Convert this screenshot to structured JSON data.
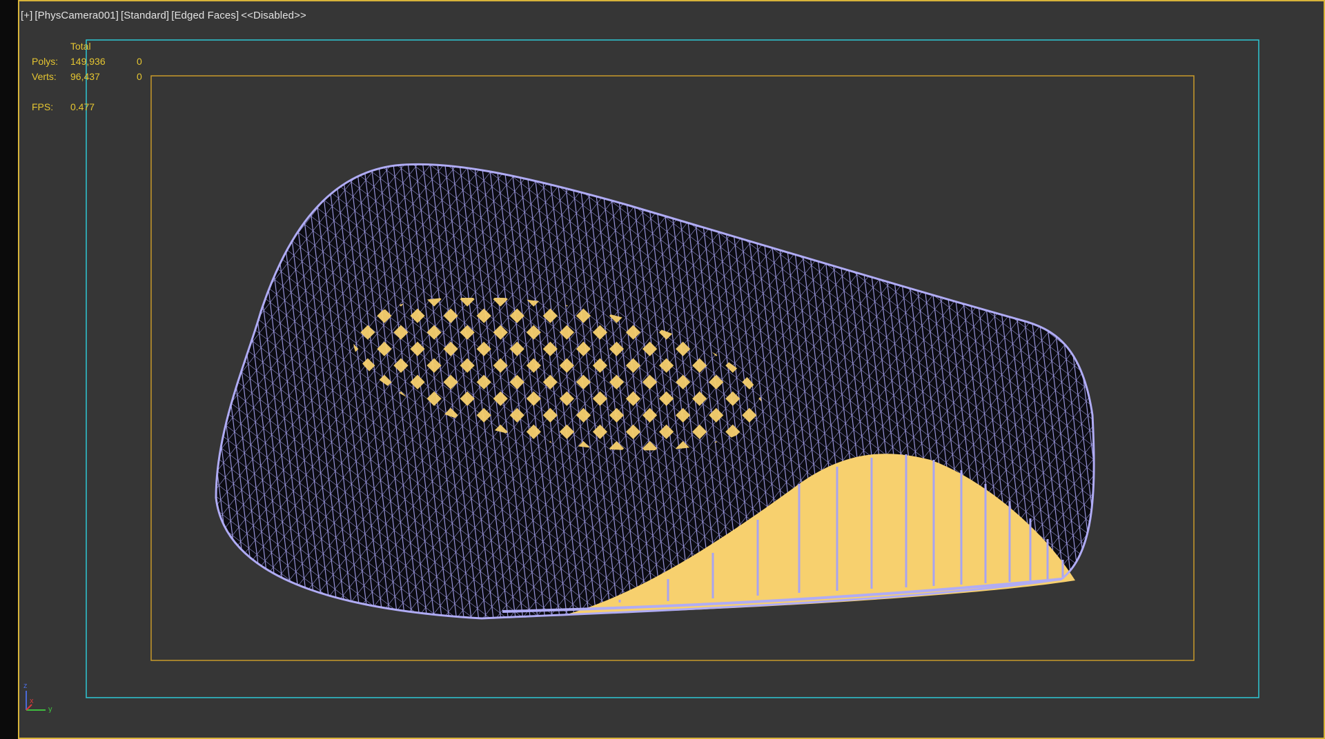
{
  "viewport": {
    "label_parts": [
      "[+]",
      "[PhysCamera001]",
      "[Standard]",
      "[Edged Faces]",
      "<<Disabled>>"
    ]
  },
  "stats": {
    "header": "Total",
    "polys_label": "Polys:",
    "polys_total": "149,936",
    "polys_selected": "0",
    "verts_label": "Verts:",
    "verts_total": "96,437",
    "verts_selected": "0",
    "fps_label": "FPS:",
    "fps_value": "0.477"
  },
  "axis": {
    "z": "z",
    "x": "x",
    "y": "y"
  },
  "colors": {
    "viewport_bg": "#363636",
    "active_border": "#d8b43a",
    "safe_frame_outer": "#2fc8d6",
    "safe_frame_inner": "#c99a2a",
    "wireframe": "#a8a4f0",
    "fill": "#f7d06e",
    "stats_text": "#e6c631"
  }
}
